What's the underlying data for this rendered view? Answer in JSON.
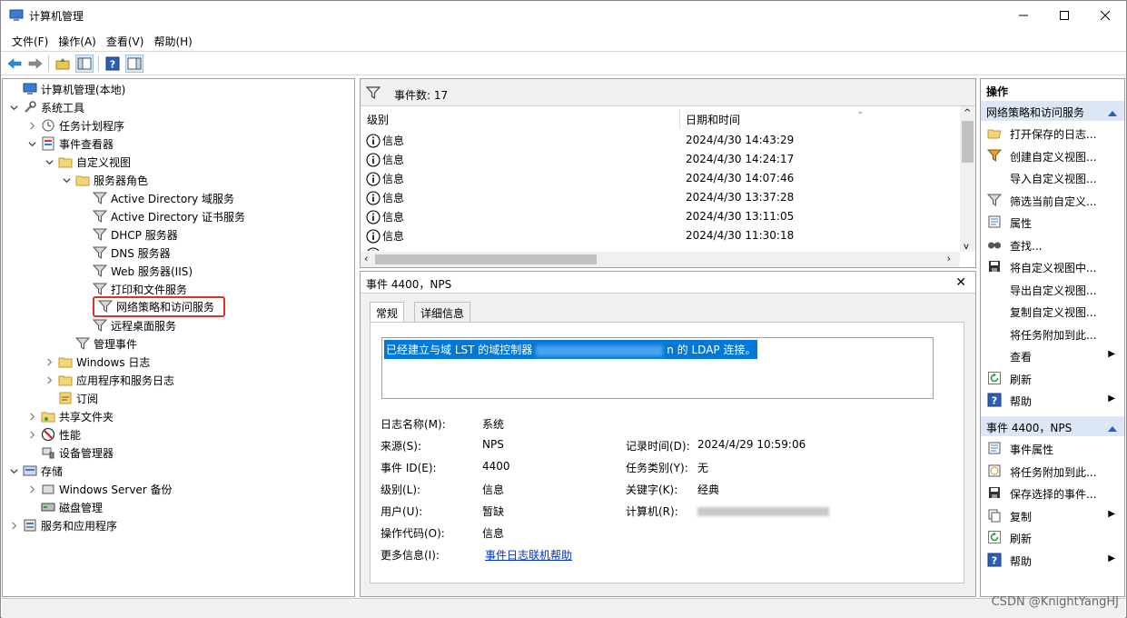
{
  "window": {
    "title": "计算机管理",
    "menus": [
      "文件(F)",
      "操作(A)",
      "查看(V)",
      "帮助(H)"
    ]
  },
  "tree": {
    "items": [
      {
        "label": "计算机管理(本地)",
        "icon": "computer-management-icon",
        "level": 0,
        "chevron": "none"
      },
      {
        "label": "系统工具",
        "icon": "system-tools-icon",
        "level": 0,
        "chevron": "down"
      },
      {
        "label": "任务计划程序",
        "icon": "task-scheduler-icon",
        "level": 1,
        "chevron": "right"
      },
      {
        "label": "事件查看器",
        "icon": "event-viewer-icon",
        "level": 1,
        "chevron": "down"
      },
      {
        "label": "自定义视图",
        "icon": "folder-icon",
        "level": 2,
        "chevron": "down"
      },
      {
        "label": "服务器角色",
        "icon": "folder-icon",
        "level": 3,
        "chevron": "down"
      },
      {
        "label": "Active Directory 域服务",
        "icon": "filter-icon",
        "level": 4,
        "chevron": "none"
      },
      {
        "label": "Active Directory 证书服务",
        "icon": "filter-icon",
        "level": 4,
        "chevron": "none"
      },
      {
        "label": "DHCP 服务器",
        "icon": "filter-icon",
        "level": 4,
        "chevron": "none"
      },
      {
        "label": "DNS 服务器",
        "icon": "filter-icon",
        "level": 4,
        "chevron": "none"
      },
      {
        "label": "Web 服务器(IIS)",
        "icon": "filter-icon",
        "level": 4,
        "chevron": "none"
      },
      {
        "label": "打印和文件服务",
        "icon": "filter-icon",
        "level": 4,
        "chevron": "none"
      },
      {
        "label": "网络策略和访问服务",
        "icon": "filter-icon",
        "level": 4,
        "chevron": "none",
        "selected": true
      },
      {
        "label": "远程桌面服务",
        "icon": "filter-icon",
        "level": 4,
        "chevron": "none"
      },
      {
        "label": "管理事件",
        "icon": "filter-icon",
        "level": 3,
        "chevron": "none"
      },
      {
        "label": "Windows 日志",
        "icon": "folder-icon",
        "level": 2,
        "chevron": "right"
      },
      {
        "label": "应用程序和服务日志",
        "icon": "folder-icon",
        "level": 2,
        "chevron": "right"
      },
      {
        "label": "订阅",
        "icon": "subscription-icon",
        "level": 2,
        "chevron": "none"
      },
      {
        "label": "共享文件夹",
        "icon": "shared-folder-icon",
        "level": 1,
        "chevron": "right"
      },
      {
        "label": "性能",
        "icon": "performance-icon",
        "level": 1,
        "chevron": "right"
      },
      {
        "label": "设备管理器",
        "icon": "device-manager-icon",
        "level": 1,
        "chevron": "none"
      },
      {
        "label": "存储",
        "icon": "storage-icon",
        "level": 0,
        "chevron": "down"
      },
      {
        "label": "Windows Server 备份",
        "icon": "backup-icon",
        "level": 1,
        "chevron": "right"
      },
      {
        "label": "磁盘管理",
        "icon": "disk-management-icon",
        "level": 1,
        "chevron": "none"
      },
      {
        "label": "服务和应用程序",
        "icon": "services-icon",
        "level": 0,
        "chevron": "right"
      }
    ]
  },
  "events": {
    "count_label": "事件数: 17",
    "col_level": "级别",
    "col_datetime": "日期和时间",
    "rows": [
      {
        "level": "信息",
        "datetime": "2024/4/30 14:43:29"
      },
      {
        "level": "信息",
        "datetime": "2024/4/30 14:24:17"
      },
      {
        "level": "信息",
        "datetime": "2024/4/30 14:07:46"
      },
      {
        "level": "信息",
        "datetime": "2024/4/30 13:37:28"
      },
      {
        "level": "信息",
        "datetime": "2024/4/30 13:11:05"
      },
      {
        "level": "信息",
        "datetime": "2024/4/30 11:30:18"
      }
    ]
  },
  "detail": {
    "header": "事件 4400，NPS",
    "tab_general": "常规",
    "tab_details": "详细信息",
    "desc_prefix": "已经建立与域 LST 的域控制器",
    "desc_suffix": "n 的 LDAP 连接。",
    "log_name_label": "日志名称(M):",
    "log_name": "系统",
    "source_label": "来源(S):",
    "source": "NPS",
    "logged_label": "记录时间(D):",
    "logged": "2024/4/29 10:59:06",
    "event_id_label": "事件 ID(E):",
    "event_id": "4400",
    "task_label": "任务类别(Y):",
    "task": "无",
    "level_label": "级别(L):",
    "level": "信息",
    "keywords_label": "关键字(K):",
    "keywords": "经典",
    "user_label": "用户(U):",
    "user": "暂缺",
    "computer_label": "计算机(R):",
    "opcode_label": "操作代码(O):",
    "opcode": "信息",
    "more_label": "更多信息(I):",
    "more_link": "事件日志联机帮助"
  },
  "actions": {
    "title": "操作",
    "section1": "网络策略和访问服务",
    "items1": [
      {
        "label": "打开保存的日志...",
        "icon": "open-log-icon",
        "arrow": false
      },
      {
        "label": "创建自定义视图...",
        "icon": "create-view-icon",
        "arrow": false
      },
      {
        "label": "导入自定义视图...",
        "icon": "",
        "arrow": false
      },
      {
        "label": "筛选当前自定义...",
        "icon": "filter-icon",
        "arrow": false
      },
      {
        "label": "属性",
        "icon": "properties-icon",
        "arrow": false
      },
      {
        "label": "查找...",
        "icon": "find-icon",
        "arrow": false
      },
      {
        "label": "将自定义视图中...",
        "icon": "save-icon",
        "arrow": false
      },
      {
        "label": "导出自定义视图...",
        "icon": "",
        "arrow": false
      },
      {
        "label": "复制自定义视图...",
        "icon": "",
        "arrow": false
      },
      {
        "label": "将任务附加到此...",
        "icon": "",
        "arrow": false
      },
      {
        "label": "查看",
        "icon": "",
        "arrow": true
      },
      {
        "label": "刷新",
        "icon": "refresh-icon",
        "arrow": false
      },
      {
        "label": "帮助",
        "icon": "help-icon",
        "arrow": true
      }
    ],
    "section2": "事件 4400，NPS",
    "items2": [
      {
        "label": "事件属性",
        "icon": "event-properties-icon",
        "arrow": false
      },
      {
        "label": "将任务附加到此...",
        "icon": "attach-task-icon",
        "arrow": false
      },
      {
        "label": "保存选择的事件...",
        "icon": "save-icon",
        "arrow": false
      },
      {
        "label": "复制",
        "icon": "copy-icon",
        "arrow": true
      },
      {
        "label": "刷新",
        "icon": "refresh-icon",
        "arrow": false
      },
      {
        "label": "帮助",
        "icon": "help-icon",
        "arrow": true
      }
    ]
  },
  "watermark": "CSDN @KnightYangHJ",
  "colors": {
    "accent": "#0078d7",
    "section_bg": "#dce6f4",
    "highlight_border": "#e0302a"
  }
}
